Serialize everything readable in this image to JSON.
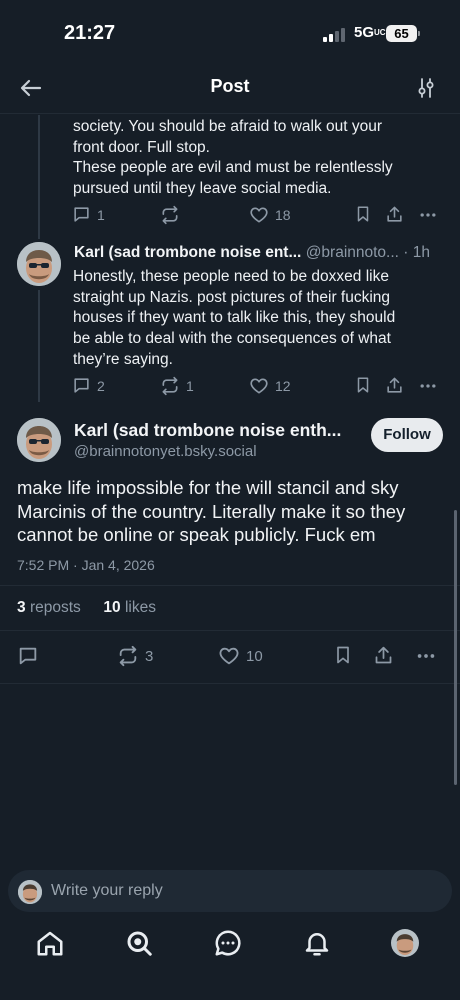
{
  "status": {
    "time": "21:27",
    "network": "5G",
    "network_sub": "UC",
    "battery": "65"
  },
  "header": {
    "title": "Post",
    "back_icon": "arrow-left-icon",
    "filter_icon": "sliders-icon"
  },
  "parent_post_tail": {
    "lines": [
      "society. You should be afraid to walk out your",
      "front door. Full stop.",
      "These people are evil and must be relentlessly",
      "pursued until they leave social media."
    ],
    "replies": "1",
    "reposts": "",
    "likes": "18"
  },
  "reply_post": {
    "name": "Karl (sad trombone noise ent...",
    "handle": "@brainnoto...",
    "age": "· 1h",
    "lines": [
      "Honestly, these people need to be doxxed like",
      "straight up Nazis. post pictures of their fucking",
      "houses if they want to talk like this, they should",
      "be able to deal with the consequences of what",
      "they’re saying."
    ],
    "replies": "2",
    "reposts": "1",
    "likes": "12"
  },
  "main_post": {
    "name": "Karl (sad trombone noise enth...",
    "handle": "@brainnotonyet.bsky.social",
    "follow_label": "Follow",
    "lines": [
      "make life impossible for the will stancil and sky",
      "Marcinis of the country. Literally make it so they",
      "cannot be online or speak publicly.  Fuck em"
    ],
    "date": "7:52 PM · Jan 4, 2026",
    "repost_count": "3",
    "repost_label": "reposts",
    "like_count": "10",
    "like_label": "likes",
    "action_reposts": "3",
    "action_likes": "10"
  },
  "reply_box": {
    "placeholder": "Write your reply"
  },
  "tabbar": {
    "items": [
      "home-icon",
      "search-icon",
      "chat-icon",
      "bell-icon",
      "profile-avatar"
    ]
  },
  "colors": {
    "background": "#161e27",
    "muted": "#8d99a6",
    "text": "#f1f3f5",
    "follow_bg": "#e8ebee"
  }
}
